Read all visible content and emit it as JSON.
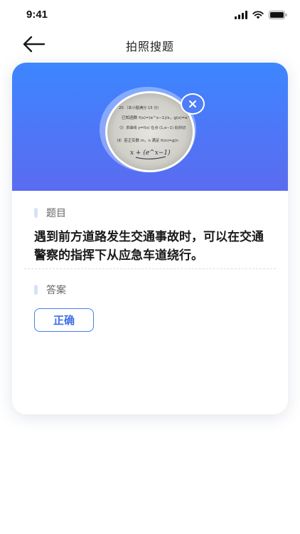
{
  "status": {
    "time": "9:41"
  },
  "nav": {
    "title": "拍照搜题",
    "back_icon": "arrow-left-icon"
  },
  "photo": {
    "lines": [
      "20.（本小题满分 15 分）",
      "已知函数 f(x)=(e^x−1)/x，g(x)=e^x.",
      "（Ⅰ）求曲线 y=f(x) 在点 (1,e−1) 处的切",
      "（Ⅱ）若正实数 m，n 满足 f(m)=g(n",
      "x + (e^x−1)"
    ],
    "close_icon": "close-icon"
  },
  "question": {
    "label": "题目",
    "text": "遇到前方道路发生交通事故时，可以在交通警察的指挥下从应急车道绕行。"
  },
  "answer": {
    "label": "答案",
    "value": "正确"
  },
  "colors": {
    "accent": "#4a7cf0",
    "header_top": "#3d86ff",
    "header_bottom": "#5a6cf0"
  }
}
